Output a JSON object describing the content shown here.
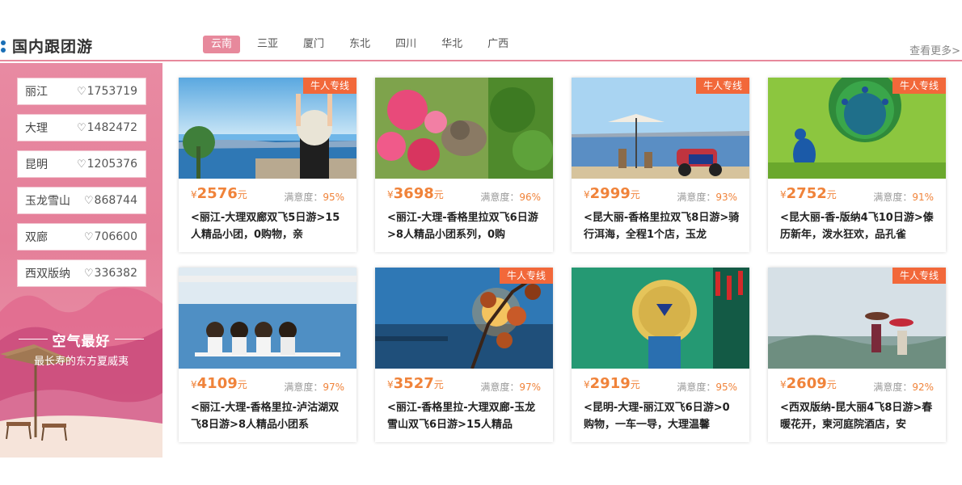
{
  "header": {
    "title": "国内跟团游",
    "tabs": [
      "云南",
      "三亚",
      "厦门",
      "东北",
      "四川",
      "华北",
      "广西"
    ],
    "active_tab": "云南",
    "more": "查看更多>"
  },
  "sidebar": {
    "items": [
      {
        "name": "丽江",
        "count": "1753719"
      },
      {
        "name": "大理",
        "count": "1482472"
      },
      {
        "name": "昆明",
        "count": "1205376"
      },
      {
        "name": "玉龙雪山",
        "count": "868744"
      },
      {
        "name": "双廊",
        "count": "706600"
      },
      {
        "name": "西双版纳",
        "count": "336382"
      }
    ],
    "slogan_title": "空气最好",
    "slogan_sub": "最长寿的东方夏威夷"
  },
  "badge_text": "牛人专线",
  "cards": [
    {
      "badge": true,
      "price": "2576",
      "currency": "¥",
      "unit": "元",
      "sat_label": "满意度：",
      "sat": "95%",
      "desc": "<丽江-大理双廊双飞5日游>15人精品小团，0购物，亲",
      "scene": "girl-lake"
    },
    {
      "badge": false,
      "price": "3698",
      "currency": "¥",
      "unit": "元",
      "sat_label": "满意度：",
      "sat": "96%",
      "desc": "<丽江-大理-香格里拉双飞6日游>8人精品小团系列，0购",
      "scene": "cat-flowers"
    },
    {
      "badge": true,
      "price": "2999",
      "currency": "¥",
      "unit": "元",
      "sat_label": "满意度：",
      "sat": "93%",
      "desc": "<昆大丽-香格里拉双飞8日游>骑行洱海，全程1个店，玉龙",
      "scene": "umbrella-scooter"
    },
    {
      "badge": true,
      "price": "2752",
      "currency": "¥",
      "unit": "元",
      "sat_label": "满意度：",
      "sat": "91%",
      "desc": "<昆大丽-香-版纳4飞10日游>傣历新年，泼水狂欢，品孔雀",
      "scene": "peacock"
    },
    {
      "badge": false,
      "price": "4109",
      "currency": "¥",
      "unit": "元",
      "sat_label": "满意度：",
      "sat": "97%",
      "desc": "<丽江-大理-香格里拉-泸沽湖双飞8日游>8人精品小团系",
      "scene": "girls-bench"
    },
    {
      "badge": true,
      "price": "3527",
      "currency": "¥",
      "unit": "元",
      "sat_label": "满意度：",
      "sat": "97%",
      "desc": "<丽江-香格里拉-大理双廊-玉龙雪山双飞6日游>15人精品",
      "scene": "sunset-branches"
    },
    {
      "badge": false,
      "price": "2919",
      "currency": "¥",
      "unit": "元",
      "sat_label": "满意度：",
      "sat": "95%",
      "desc": "<昆明-大理-丽江双飞6日游>0购物，一车一导，大理温馨",
      "scene": "straw-hat"
    },
    {
      "badge": true,
      "price": "2609",
      "currency": "¥",
      "unit": "元",
      "sat_label": "满意度：",
      "sat": "92%",
      "desc": "<西双版纳-昆大丽4飞8日游>春暖花开，柬河庭院酒店，安",
      "scene": "couple-umbrellas"
    }
  ]
}
